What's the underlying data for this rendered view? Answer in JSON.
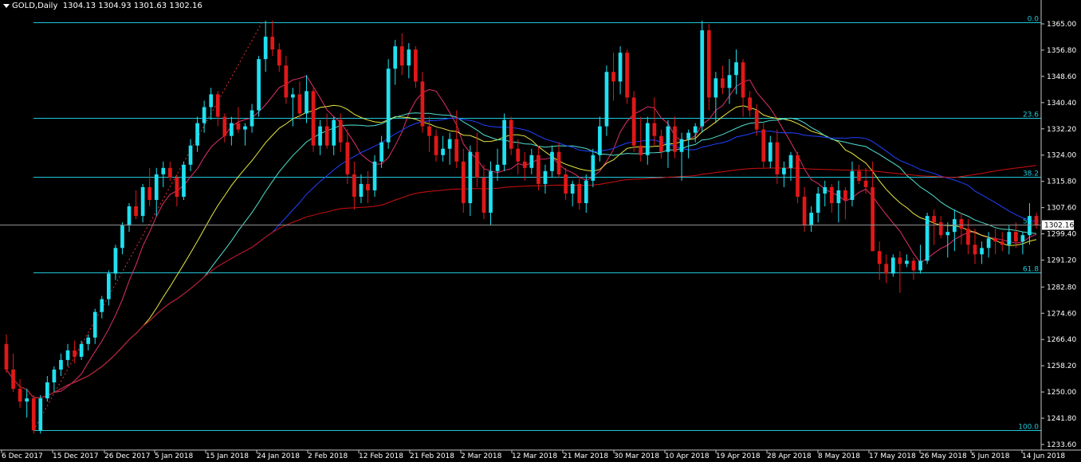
{
  "header": {
    "symbol": "GOLD,Daily",
    "ohlc": "1304.13 1304.93 1301.63 1302.16"
  },
  "chart_data": {
    "type": "candlestick",
    "ylim": [
      1233.6,
      1369.0
    ],
    "y_ticks": [
      "1365.00",
      "1356.80",
      "1348.60",
      "1340.40",
      "1332.20",
      "1324.00",
      "1315.80",
      "1307.60",
      "1299.40",
      "1291.20",
      "1282.80",
      "1274.60",
      "1266.40",
      "1258.20",
      "1250.00",
      "1241.80",
      "1233.60"
    ],
    "x_labels": [
      "6 Dec 2017",
      "15 Dec 2017",
      "26 Dec 2017",
      "5 Jan 2018",
      "15 Jan 2018",
      "24 Jan 2018",
      "2 Feb 2018",
      "12 Feb 2018",
      "21 Feb 2018",
      "2 Mar 2018",
      "12 Mar 2018",
      "21 Mar 2018",
      "30 Mar 2018",
      "10 Apr 2018",
      "19 Apr 2018",
      "28 Apr 2018",
      "8 May 2018",
      "17 May 2018",
      "26 May 2018",
      "5 Jun 2018",
      "14 Jun 2018"
    ],
    "current_price": "1302.16",
    "fibonacci": [
      {
        "label": "0.0",
        "value": 1365.4
      },
      {
        "label": "23.6",
        "value": 1335.6
      },
      {
        "label": "38.2",
        "value": 1317.2
      },
      {
        "label": "50.0",
        "value": 1302.3
      },
      {
        "label": "61.8",
        "value": 1287.4
      },
      {
        "label": "100.0",
        "value": 1238.0
      }
    ],
    "candles": [
      [
        1265,
        1268,
        1256,
        1257
      ],
      [
        1257,
        1262,
        1250,
        1251
      ],
      [
        1251,
        1254,
        1245,
        1247
      ],
      [
        1247,
        1251,
        1242,
        1248
      ],
      [
        1248,
        1249,
        1237,
        1238
      ],
      [
        1238,
        1249,
        1237,
        1248
      ],
      [
        1248,
        1255,
        1247,
        1253
      ],
      [
        1253,
        1258,
        1250,
        1257
      ],
      [
        1257,
        1262,
        1255,
        1260
      ],
      [
        1260,
        1265,
        1258,
        1263
      ],
      [
        1263,
        1266,
        1259,
        1261
      ],
      [
        1261,
        1266,
        1260,
        1265
      ],
      [
        1265,
        1268,
        1263,
        1267
      ],
      [
        1267,
        1276,
        1265,
        1275
      ],
      [
        1275,
        1280,
        1273,
        1279
      ],
      [
        1279,
        1288,
        1277,
        1287
      ],
      [
        1287,
        1296,
        1285,
        1295
      ],
      [
        1295,
        1303,
        1293,
        1302
      ],
      [
        1302,
        1309,
        1300,
        1308
      ],
      [
        1308,
        1313,
        1304,
        1305
      ],
      [
        1305,
        1315,
        1303,
        1314
      ],
      [
        1314,
        1320,
        1308,
        1310
      ],
      [
        1310,
        1320,
        1305,
        1318
      ],
      [
        1318,
        1322,
        1314,
        1320
      ],
      [
        1320,
        1322,
        1316,
        1317
      ],
      [
        1317,
        1318,
        1308,
        1311
      ],
      [
        1311,
        1322,
        1310,
        1321
      ],
      [
        1321,
        1329,
        1319,
        1327
      ],
      [
        1327,
        1336,
        1325,
        1334
      ],
      [
        1334,
        1341,
        1331,
        1339
      ],
      [
        1339,
        1345,
        1335,
        1343
      ],
      [
        1343,
        1344,
        1333,
        1336
      ],
      [
        1336,
        1337,
        1328,
        1330
      ],
      [
        1330,
        1336,
        1327,
        1334
      ],
      [
        1334,
        1339,
        1331,
        1332
      ],
      [
        1332,
        1334,
        1327,
        1333
      ],
      [
        1333,
        1340,
        1331,
        1338
      ],
      [
        1338,
        1355,
        1336,
        1354
      ],
      [
        1354,
        1366,
        1350,
        1361
      ],
      [
        1361,
        1366,
        1355,
        1357
      ],
      [
        1357,
        1359,
        1350,
        1352
      ],
      [
        1352,
        1355,
        1340,
        1342
      ],
      [
        1342,
        1345,
        1333,
        1343
      ],
      [
        1343,
        1347,
        1335,
        1337
      ],
      [
        1337,
        1349,
        1334,
        1344
      ],
      [
        1344,
        1345,
        1325,
        1327
      ],
      [
        1327,
        1335,
        1324,
        1333
      ],
      [
        1333,
        1337,
        1326,
        1327
      ],
      [
        1327,
        1336,
        1324,
        1335
      ],
      [
        1335,
        1337,
        1325,
        1328
      ],
      [
        1328,
        1332,
        1315,
        1318
      ],
      [
        1318,
        1322,
        1307,
        1311
      ],
      [
        1311,
        1318,
        1309,
        1315
      ],
      [
        1315,
        1319,
        1309,
        1313
      ],
      [
        1313,
        1324,
        1311,
        1322
      ],
      [
        1322,
        1330,
        1320,
        1328
      ],
      [
        1328,
        1354,
        1326,
        1351
      ],
      [
        1351,
        1360,
        1346,
        1358
      ],
      [
        1358,
        1362,
        1349,
        1352
      ],
      [
        1352,
        1359,
        1348,
        1357
      ],
      [
        1357,
        1358,
        1345,
        1347
      ],
      [
        1347,
        1350,
        1331,
        1333
      ],
      [
        1333,
        1336,
        1325,
        1330
      ],
      [
        1330,
        1332,
        1322,
        1324
      ],
      [
        1324,
        1330,
        1322,
        1326
      ],
      [
        1326,
        1331,
        1321,
        1329
      ],
      [
        1329,
        1338,
        1320,
        1322
      ],
      [
        1322,
        1326,
        1306,
        1309
      ],
      [
        1309,
        1327,
        1305,
        1325
      ],
      [
        1325,
        1331,
        1314,
        1317
      ],
      [
        1317,
        1321,
        1304,
        1306
      ],
      [
        1306,
        1322,
        1302,
        1319
      ],
      [
        1319,
        1326,
        1316,
        1321
      ],
      [
        1321,
        1337,
        1319,
        1335
      ],
      [
        1335,
        1336,
        1324,
        1326
      ],
      [
        1326,
        1329,
        1318,
        1322
      ],
      [
        1322,
        1325,
        1316,
        1320
      ],
      [
        1320,
        1326,
        1318,
        1324
      ],
      [
        1324,
        1327,
        1313,
        1315
      ],
      [
        1315,
        1321,
        1312,
        1319
      ],
      [
        1319,
        1327,
        1317,
        1325
      ],
      [
        1325,
        1328,
        1317,
        1318
      ],
      [
        1318,
        1320,
        1310,
        1312
      ],
      [
        1312,
        1316,
        1308,
        1315
      ],
      [
        1315,
        1317,
        1307,
        1309
      ],
      [
        1309,
        1318,
        1306,
        1316
      ],
      [
        1316,
        1326,
        1314,
        1324
      ],
      [
        1324,
        1336,
        1322,
        1333
      ],
      [
        1333,
        1352,
        1330,
        1350
      ],
      [
        1350,
        1356,
        1341,
        1347
      ],
      [
        1347,
        1358,
        1343,
        1356
      ],
      [
        1356,
        1357,
        1340,
        1342
      ],
      [
        1342,
        1344,
        1325,
        1327
      ],
      [
        1327,
        1336,
        1322,
        1324
      ],
      [
        1324,
        1336,
        1321,
        1334
      ],
      [
        1334,
        1342,
        1327,
        1330
      ],
      [
        1330,
        1332,
        1323,
        1325
      ],
      [
        1325,
        1335,
        1320,
        1333
      ],
      [
        1333,
        1336,
        1323,
        1325
      ],
      [
        1325,
        1331,
        1316,
        1329
      ],
      [
        1329,
        1332,
        1323,
        1331
      ],
      [
        1331,
        1334,
        1328,
        1333
      ],
      [
        1333,
        1366,
        1331,
        1363
      ],
      [
        1363,
        1365,
        1338,
        1342
      ],
      [
        1342,
        1350,
        1334,
        1348
      ],
      [
        1348,
        1352,
        1343,
        1345
      ],
      [
        1345,
        1354,
        1340,
        1349
      ],
      [
        1349,
        1357,
        1343,
        1353
      ],
      [
        1353,
        1354,
        1336,
        1342
      ],
      [
        1342,
        1344,
        1336,
        1338
      ],
      [
        1338,
        1340,
        1330,
        1332
      ],
      [
        1332,
        1334,
        1320,
        1322
      ],
      [
        1322,
        1330,
        1320,
        1328
      ],
      [
        1328,
        1332,
        1315,
        1318
      ],
      [
        1318,
        1322,
        1314,
        1320
      ],
      [
        1320,
        1325,
        1316,
        1324
      ],
      [
        1324,
        1325,
        1309,
        1311
      ],
      [
        1311,
        1314,
        1300,
        1302
      ],
      [
        1302,
        1308,
        1300,
        1306
      ],
      [
        1306,
        1314,
        1303,
        1312
      ],
      [
        1312,
        1316,
        1308,
        1314
      ],
      [
        1314,
        1315,
        1306,
        1309
      ],
      [
        1309,
        1316,
        1303,
        1313
      ],
      [
        1313,
        1314,
        1304,
        1310
      ],
      [
        1310,
        1322,
        1308,
        1319
      ],
      [
        1319,
        1321,
        1315,
        1316
      ],
      [
        1316,
        1320,
        1312,
        1314
      ],
      [
        1314,
        1322,
        1295,
        1294
      ],
      [
        1294,
        1297,
        1285,
        1290
      ],
      [
        1290,
        1293,
        1284,
        1287
      ],
      [
        1287,
        1293,
        1286,
        1292
      ],
      [
        1292,
        1294,
        1281,
        1290
      ],
      [
        1290,
        1293,
        1289,
        1291
      ],
      [
        1291,
        1292,
        1285,
        1288
      ],
      [
        1288,
        1296,
        1287,
        1291
      ],
      [
        1291,
        1306,
        1290,
        1305
      ],
      [
        1305,
        1307,
        1296,
        1303
      ],
      [
        1303,
        1305,
        1298,
        1299
      ],
      [
        1299,
        1303,
        1292,
        1300
      ],
      [
        1300,
        1307,
        1294,
        1304
      ],
      [
        1304,
        1306,
        1296,
        1301
      ],
      [
        1301,
        1304,
        1293,
        1296
      ],
      [
        1296,
        1301,
        1290,
        1293
      ],
      [
        1293,
        1297,
        1290,
        1295
      ],
      [
        1295,
        1300,
        1292,
        1298
      ],
      [
        1298,
        1301,
        1293,
        1297
      ],
      [
        1297,
        1300,
        1294,
        1296
      ],
      [
        1296,
        1302,
        1293,
        1300
      ],
      [
        1300,
        1303,
        1295,
        1297
      ],
      [
        1297,
        1300,
        1293,
        1299
      ],
      [
        1299,
        1309,
        1296,
        1305
      ],
      [
        1305,
        1306,
        1301,
        1302
      ]
    ]
  }
}
